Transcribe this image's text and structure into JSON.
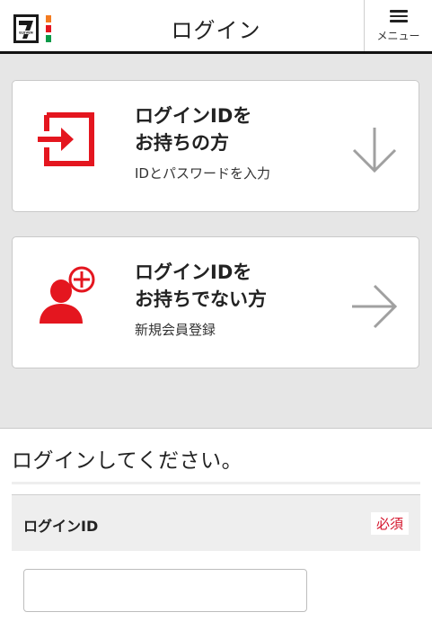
{
  "header": {
    "title": "ログイン",
    "menu_label": "メニュー",
    "logo_text": "ELEVEN"
  },
  "cards": [
    {
      "title_line1": "ログインIDを",
      "title_line2": "お持ちの方",
      "subtitle": "IDとパスワードを入力",
      "icon": "login-enter-icon",
      "arrow": "arrow-down-icon"
    },
    {
      "title_line1": "ログインIDを",
      "title_line2": "お持ちでない方",
      "subtitle": "新規会員登録",
      "icon": "add-user-icon",
      "arrow": "arrow-right-icon"
    }
  ],
  "login": {
    "prompt": "ログインしてください。",
    "id_label": "ログインID",
    "required_badge": "必須",
    "id_value": ""
  },
  "colors": {
    "accent_red": "#e4161f",
    "arrow_gray": "#a0a0a0",
    "background": "#e6e6e6"
  }
}
